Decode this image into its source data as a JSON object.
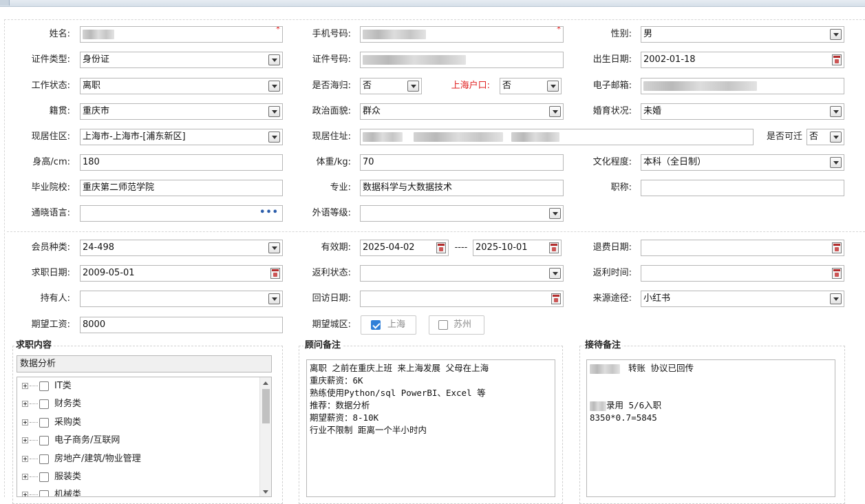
{
  "top_form": {
    "name_label": "姓名:",
    "phone_label": "手机号码:",
    "gender_label": "性别:",
    "gender_value": "男",
    "idtype_label": "证件类型:",
    "idtype_value": "身份证",
    "idno_label": "证件号码:",
    "birth_label": "出生日期:",
    "birth_value": "2002-01-18",
    "workstatus_label": "工作状态:",
    "workstatus_value": "离职",
    "returnee_label": "是否海归:",
    "returnee_value": "否",
    "shanghai_hukou_label": "上海户口:",
    "shanghai_hukou_value": "否",
    "email_label": "电子邮箱:",
    "native_label": "籍贯:",
    "native_value": "重庆市",
    "political_label": "政治面貌:",
    "political_value": "群众",
    "marital_label": "婚育状况:",
    "marital_value": "未婚",
    "district_label": "现居住区:",
    "district_value": "上海市-上海市-[浦东新区]",
    "address_label": "现居住址:",
    "relocate_label": "是否可迁",
    "relocate_value": "否",
    "height_label": "身高/cm:",
    "height_value": "180",
    "weight_label": "体重/kg:",
    "weight_value": "70",
    "education_label": "文化程度:",
    "education_value": "本科（全日制）",
    "school_label": "毕业院校:",
    "school_value": "重庆第二师范学院",
    "major_label": "专业:",
    "major_value": "数据科学与大数据技术",
    "title_label": "职称:",
    "title_value": "",
    "languages_label": "通晓语言:",
    "foreign_level_label": "外语等级:"
  },
  "member_form": {
    "member_type_label": "会员种类:",
    "member_type_value": "24-498",
    "valid_label": "有效期:",
    "valid_from": "2025-04-02",
    "valid_sep": "----",
    "valid_to": "2025-10-01",
    "refund_date_label": "退费日期:",
    "job_date_label": "求职日期:",
    "job_date_value": "2009-05-01",
    "rebate_status_label": "返利状态:",
    "rebate_time_label": "返利时间:",
    "holder_label": "持有人:",
    "visit_date_label": "回访日期:",
    "source_label": "来源途径:",
    "source_value": "小红书",
    "salary_label": "期望工资:",
    "salary_value": "8000",
    "city_label": "期望城区:",
    "city_options": [
      {
        "label": "上海",
        "checked": true
      },
      {
        "label": "苏州",
        "checked": false
      }
    ]
  },
  "job_panel": {
    "title": "求职内容",
    "selected": "数据分析",
    "tree_items": [
      "IT类",
      "财务类",
      "采购类",
      "电子商务/互联网",
      "房地产/建筑/物业管理",
      "服装类",
      "机械类"
    ]
  },
  "advisor_panel": {
    "title": "顾问备注",
    "lines": [
      "离职 之前在重庆上班 来上海发展 父母在上海",
      "重庆薪资：6K",
      "熟练使用Python/sql PowerBI、Excel 等",
      "推荐：数据分析",
      "期望薪资：8-10K",
      "行业不限制 距离一个半小时内"
    ]
  },
  "reception_panel": {
    "title": "接待备注",
    "line1_suffix": "转账 协议已回传",
    "line2_suffix": "录用 5/6入职",
    "line3": "8350*0.7=5845"
  },
  "icons": {
    "dropdown": "chevron-down-icon",
    "calendar": "calendar-icon",
    "more": "ellipsis-icon",
    "required": "asterisk-icon"
  },
  "colors": {
    "required": "#e02020",
    "checkbox_checked": "#2f7fd8"
  }
}
